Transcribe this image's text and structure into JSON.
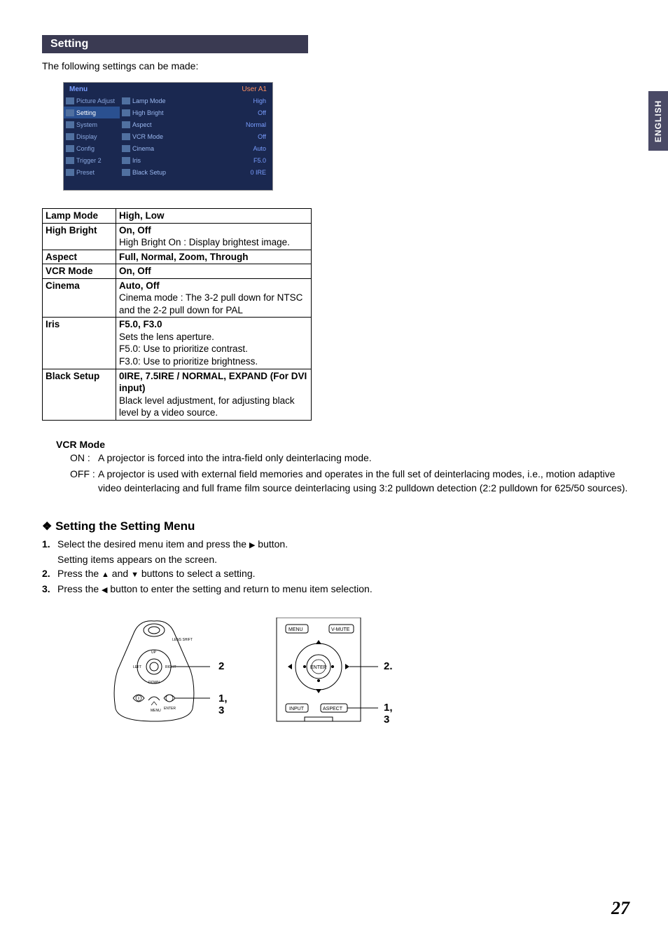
{
  "section_title": "Setting",
  "intro": "The following settings can be made:",
  "side_tab": "ENGLISH",
  "osd": {
    "menu_label": "Menu",
    "user_label": "User A1",
    "left": [
      "Picture Adjust",
      "Setting",
      "System",
      "Display",
      "Config",
      "Trigger 2",
      "Preset"
    ],
    "selected_left_index": 1,
    "right": [
      {
        "label": "Lamp Mode",
        "value": "High"
      },
      {
        "label": "High Bright",
        "value": "Off"
      },
      {
        "label": "Aspect",
        "value": "Normal"
      },
      {
        "label": "VCR Mode",
        "value": "Off"
      },
      {
        "label": "Cinema",
        "value": "Auto"
      },
      {
        "label": "Iris",
        "value": "F5.0"
      },
      {
        "label": "Black Setup",
        "value": "0 IRE"
      }
    ]
  },
  "settings_table": [
    {
      "name": "Lamp Mode",
      "options": "High, Low",
      "desc_lines": []
    },
    {
      "name": "High Bright",
      "options": "On, Off",
      "desc_lines": [
        "High Bright On : Display brightest image."
      ]
    },
    {
      "name": "Aspect",
      "options": "Full, Normal, Zoom, Through",
      "desc_lines": []
    },
    {
      "name": "VCR Mode",
      "options": "On, Off",
      "desc_lines": []
    },
    {
      "name": "Cinema",
      "options": "Auto, Off",
      "desc_lines": [
        "Cinema mode : The 3-2 pull down for NTSC and the 2-2 pull down for PAL"
      ]
    },
    {
      "name": "Iris",
      "options": "F5.0, F3.0",
      "desc_lines": [
        "Sets the lens aperture.",
        "F5.0: Use to prioritize contrast.",
        "F3.0: Use to prioritize brightness."
      ]
    },
    {
      "name": "Black Setup",
      "options": "0IRE, 7.5IRE / NORMAL, EXPAND (For DVI input)",
      "desc_lines": [
        "Black level adjustment, for adjusting black level by a video source."
      ]
    }
  ],
  "vcr_mode": {
    "title": "VCR Mode",
    "on_label": "ON :",
    "on_desc": "A projector is forced into the intra-field only deinterlacing mode.",
    "off_label": "OFF :",
    "off_desc": "A projector is used with external field memories and operates in the full set of deinterlacing modes, i.e., motion adaptive video deinterlacing and full frame film source deinterlacing using 3:2 pulldown detection (2:2 pulldown for 625/50 sources)."
  },
  "sub_section": {
    "title": "Setting the Setting Menu",
    "steps": [
      {
        "num": "1.",
        "text_before": "Select the desired menu item and press the ",
        "icon": "▶",
        "text_after": " button.",
        "sub": "Setting items appears on the screen."
      },
      {
        "num": "2.",
        "text_before": "Press the ",
        "icon": "▲",
        "text_mid": " and ",
        "icon2": "▼",
        "text_after": " buttons to select a setting."
      },
      {
        "num": "3.",
        "text_before": "Press the ",
        "icon": "◀",
        "text_after": " button to enter the setting and return to menu item selection."
      }
    ]
  },
  "diagram_labels": {
    "d1_a": "2",
    "d1_b": "1, 3",
    "d2_a": "2.",
    "d2_b": "1, 3",
    "d2_menu": "MENU",
    "d2_vmute": "V-MUTE",
    "d2_enter": "ENTER",
    "d2_input": "INPUT",
    "d2_aspect": "ASPECT"
  },
  "page_number": "27"
}
